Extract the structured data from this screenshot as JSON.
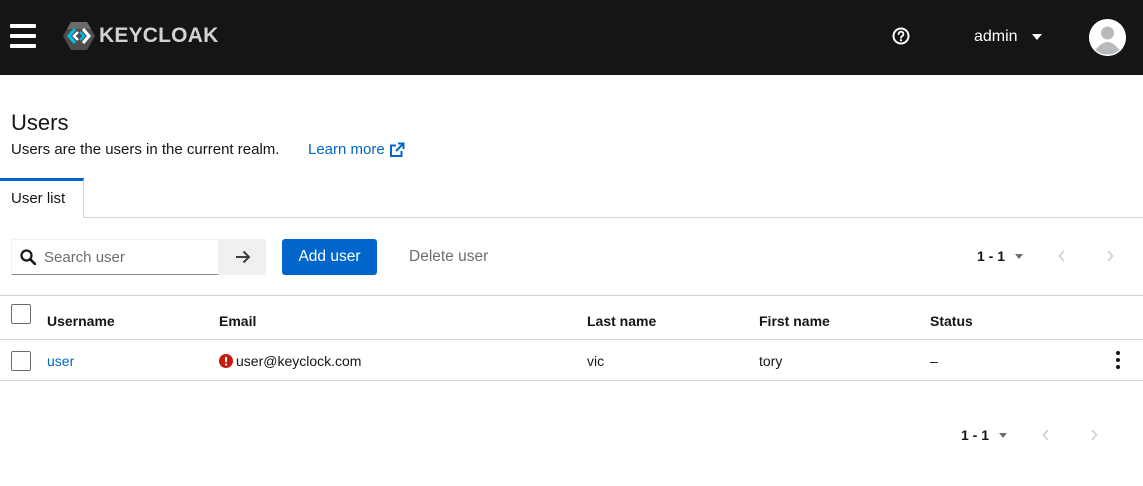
{
  "masthead": {
    "brand_text": "KEYCLOAK",
    "user_name": "admin",
    "colors": {
      "background": "#151515",
      "brand": "#d2d2d2"
    }
  },
  "page": {
    "title": "Users",
    "description": "Users are the users in the current realm.",
    "learn_more": "Learn more"
  },
  "tabs": [
    {
      "label": "User list",
      "active": true
    }
  ],
  "toolbar": {
    "search_placeholder": "Search user",
    "search_value": "",
    "add_user_label": "Add user",
    "delete_user_label": "Delete user"
  },
  "pagination": {
    "range_top": "1 - 1",
    "range_bottom": "1 - 1"
  },
  "table": {
    "columns": [
      "Username",
      "Email",
      "Last name",
      "First name",
      "Status"
    ],
    "rows": [
      {
        "username": "user",
        "email": "user@keyclock.com",
        "email_status_icon": "exclamation-circle-icon",
        "last_name": "vic",
        "first_name": "tory",
        "status": "–"
      }
    ]
  },
  "icons": {
    "menu": "hamburger-icon",
    "help": "help-circle-icon",
    "search": "search-icon",
    "go": "arrow-right-icon",
    "external": "external-link-icon",
    "prev": "chevron-left-icon",
    "next": "chevron-right-icon",
    "row_actions": "kebab-icon"
  },
  "colors": {
    "primary": "#0066cc",
    "danger": "#c9190b",
    "border": "#d2d2d2",
    "muted": "#6a6e73"
  }
}
